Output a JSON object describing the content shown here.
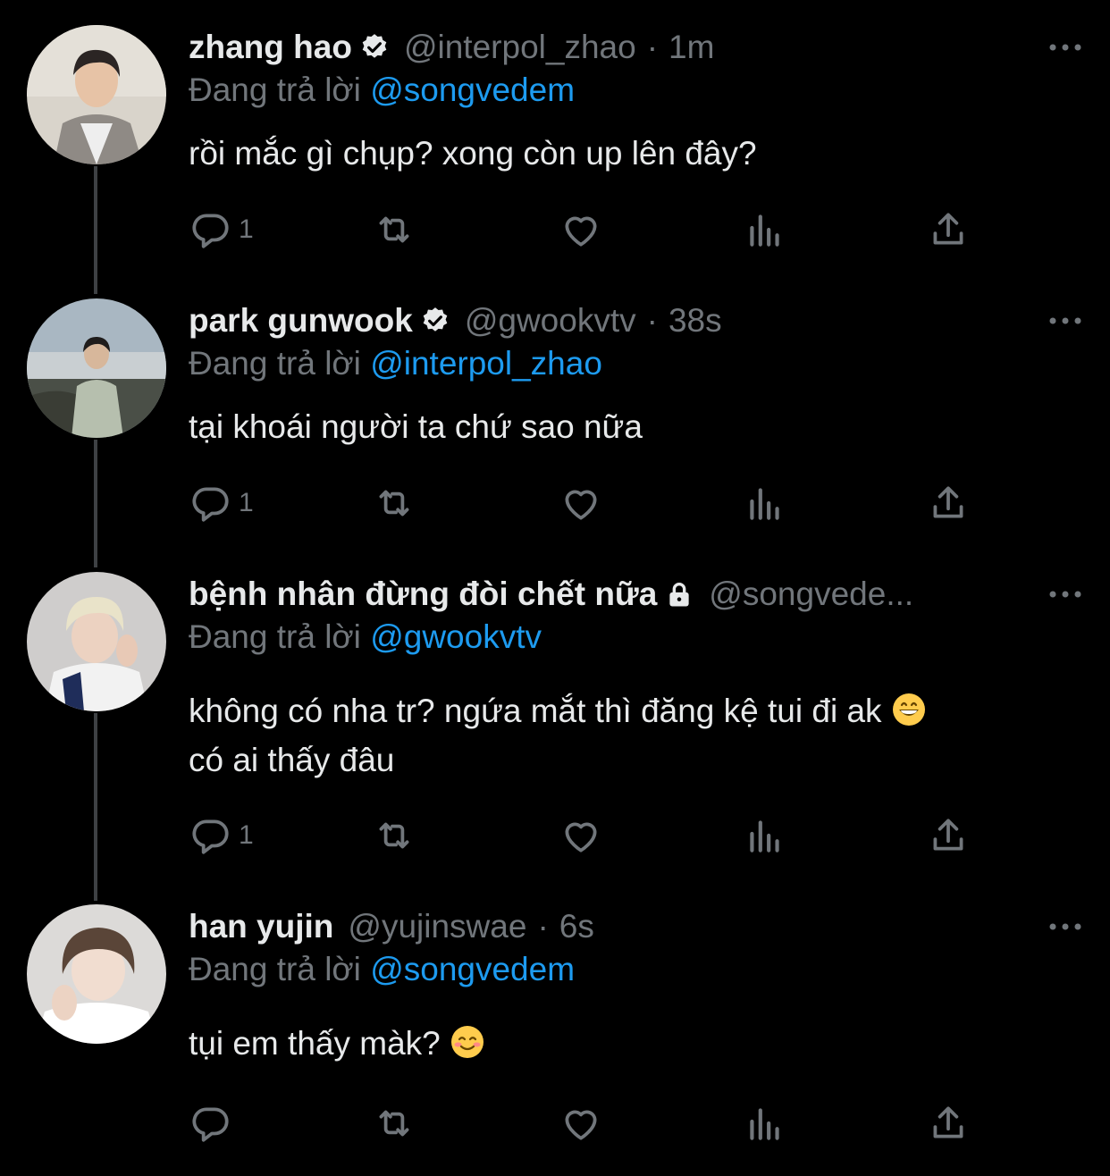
{
  "reply_prefix": "Đang trả lời",
  "tweets": [
    {
      "name": "zhang hao",
      "verified": true,
      "handle": "@interpol_zhao",
      "separator": "·",
      "time": "1m",
      "reply_to": "@songvedem",
      "text": "rồi mắc gì chụp? xong còn up lên đây?",
      "reply_count": "1"
    },
    {
      "name": "park gunwook",
      "verified": true,
      "handle": "@gwookvtv",
      "separator": "·",
      "time": "38s",
      "reply_to": "@interpol_zhao",
      "text": "tại khoái người ta chứ sao nữa",
      "reply_count": "1"
    },
    {
      "name": "bệnh nhân đừng đòi chết nữa",
      "locked": true,
      "handle": "@songvede...",
      "reply_to": "@gwookvtv",
      "text_line1": "không có nha tr? ngứa mắt thì đăng kệ tui đi ak",
      "text_line2": "có ai thấy đâu",
      "emoji": "grinning-face",
      "reply_count": "1"
    },
    {
      "name": "han yujin",
      "verified": false,
      "handle": "@yujinswae",
      "separator": "·",
      "time": "6s",
      "reply_to": "@songvedem",
      "text": "tụi em thấy màk?",
      "emoji": "smiling-face",
      "reply_count": ""
    }
  ],
  "icons": [
    "reply-icon",
    "retweet-icon",
    "like-icon",
    "views-icon",
    "share-icon",
    "more-icon",
    "verified-badge-icon",
    "lock-icon"
  ],
  "colors": {
    "background": "#000000",
    "text": "#e7e9ea",
    "muted": "#71767b",
    "link": "#1d9bf0",
    "thread": "#3e4144"
  }
}
